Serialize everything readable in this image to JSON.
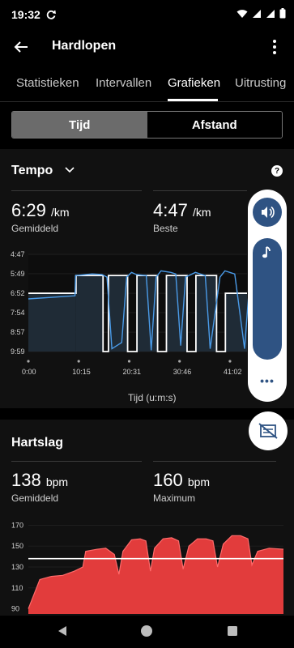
{
  "status": {
    "time": "19:32"
  },
  "app": {
    "title": "Hardlopen"
  },
  "tabs": [
    {
      "label": "Statistieken"
    },
    {
      "label": "Intervallen"
    },
    {
      "label": "Grafieken"
    },
    {
      "label": "Uitrusting"
    }
  ],
  "segment": {
    "time_label": "Tijd",
    "distance_label": "Afstand"
  },
  "tempo": {
    "title": "Tempo",
    "avg_value": "6:29",
    "avg_unit": "/km",
    "avg_label": "Gemiddeld",
    "best_value": "4:47",
    "best_unit": "/km",
    "best_label": "Beste",
    "x_title": "Tijd (u:m:s)"
  },
  "heartrate": {
    "title": "Hartslag",
    "avg_value": "138",
    "avg_unit": "bpm",
    "avg_label": "Gemiddeld",
    "max_value": "160",
    "max_unit": "bpm",
    "max_label": "Maximum"
  },
  "colors": {
    "tempo_line": "#4a9be8",
    "tempo_fill": "#1f2b36",
    "hr_fill": "#e23c3c",
    "hr_top": "#ff6b6b",
    "accent": "#2f5383"
  },
  "icons": {
    "back": "arrow-left-icon",
    "more": "more-vert-icon",
    "sound": "volume-icon",
    "music": "music-note-icon",
    "map_off": "map-off-icon"
  },
  "chart_data": [
    {
      "type": "area",
      "title": "Tempo",
      "xlabel": "Tijd (u:m:s)",
      "x_ticks": [
        "0:00",
        "10:15",
        "20:31",
        "30:46",
        "41:02"
      ],
      "y_ticks": [
        "4:47",
        "5:49",
        "6:52",
        "7:54",
        "8:57",
        "9:59"
      ],
      "y_ticks_sec": [
        287,
        349,
        412,
        474,
        537,
        599
      ],
      "y_inverted": true,
      "ylim_sec": [
        287,
        599
      ],
      "series": [
        {
          "x_min": [
            0,
            9.5,
            9.6,
            13,
            15,
            16,
            17,
            19,
            20,
            21,
            22,
            24,
            25,
            26,
            27,
            29,
            30,
            31,
            32,
            34,
            35,
            36,
            37,
            39,
            40,
            41,
            42,
            44,
            45
          ],
          "pace_sec": [
            430,
            420,
            355,
            350,
            352,
            360,
            590,
            570,
            360,
            345,
            352,
            355,
            595,
            360,
            340,
            345,
            350,
            580,
            360,
            345,
            350,
            355,
            590,
            360,
            340,
            345,
            350,
            590,
            380
          ]
        }
      ],
      "step_intervals": [
        {
          "from": 0,
          "to": 9.7,
          "pace_sec": 412
        },
        {
          "from": 9.7,
          "to": 15.2,
          "pace_sec": 355
        },
        {
          "from": 15.2,
          "to": 16.3,
          "pace_sec": 599
        },
        {
          "from": 16.3,
          "to": 20.2,
          "pace_sec": 355
        },
        {
          "from": 20.2,
          "to": 22.1,
          "pace_sec": 599
        },
        {
          "from": 22.1,
          "to": 26.3,
          "pace_sec": 355
        },
        {
          "from": 26.3,
          "to": 28.1,
          "pace_sec": 599
        },
        {
          "from": 28.1,
          "to": 32.3,
          "pace_sec": 355
        },
        {
          "from": 32.3,
          "to": 34.1,
          "pace_sec": 599
        },
        {
          "from": 34.1,
          "to": 38.3,
          "pace_sec": 355
        },
        {
          "from": 38.3,
          "to": 40.1,
          "pace_sec": 599
        },
        {
          "from": 40.1,
          "to": 44.5,
          "pace_sec": 412
        }
      ],
      "xlim_min": [
        0,
        44.5
      ]
    },
    {
      "type": "area",
      "title": "Hartslag",
      "y_ticks": [
        90,
        110,
        130,
        150,
        170
      ],
      "ylim": [
        85,
        175
      ],
      "average": 138,
      "x_min": [
        0,
        2,
        4,
        6,
        8,
        9.5,
        10,
        12,
        13.5,
        15,
        15.8,
        16.5,
        18,
        19.5,
        20.5,
        21.3,
        22,
        23.5,
        25,
        26.2,
        27,
        28,
        29.5,
        31,
        32.2,
        33,
        34,
        35.5,
        37,
        38.3,
        39,
        40,
        42,
        44.5
      ],
      "values": [
        90,
        118,
        121,
        122,
        126,
        130,
        145,
        147,
        148,
        142,
        123,
        145,
        156,
        157,
        155,
        126,
        148,
        157,
        158,
        155,
        128,
        150,
        157,
        157,
        155,
        130,
        152,
        160,
        160,
        157,
        132,
        145,
        148,
        147
      ]
    }
  ]
}
